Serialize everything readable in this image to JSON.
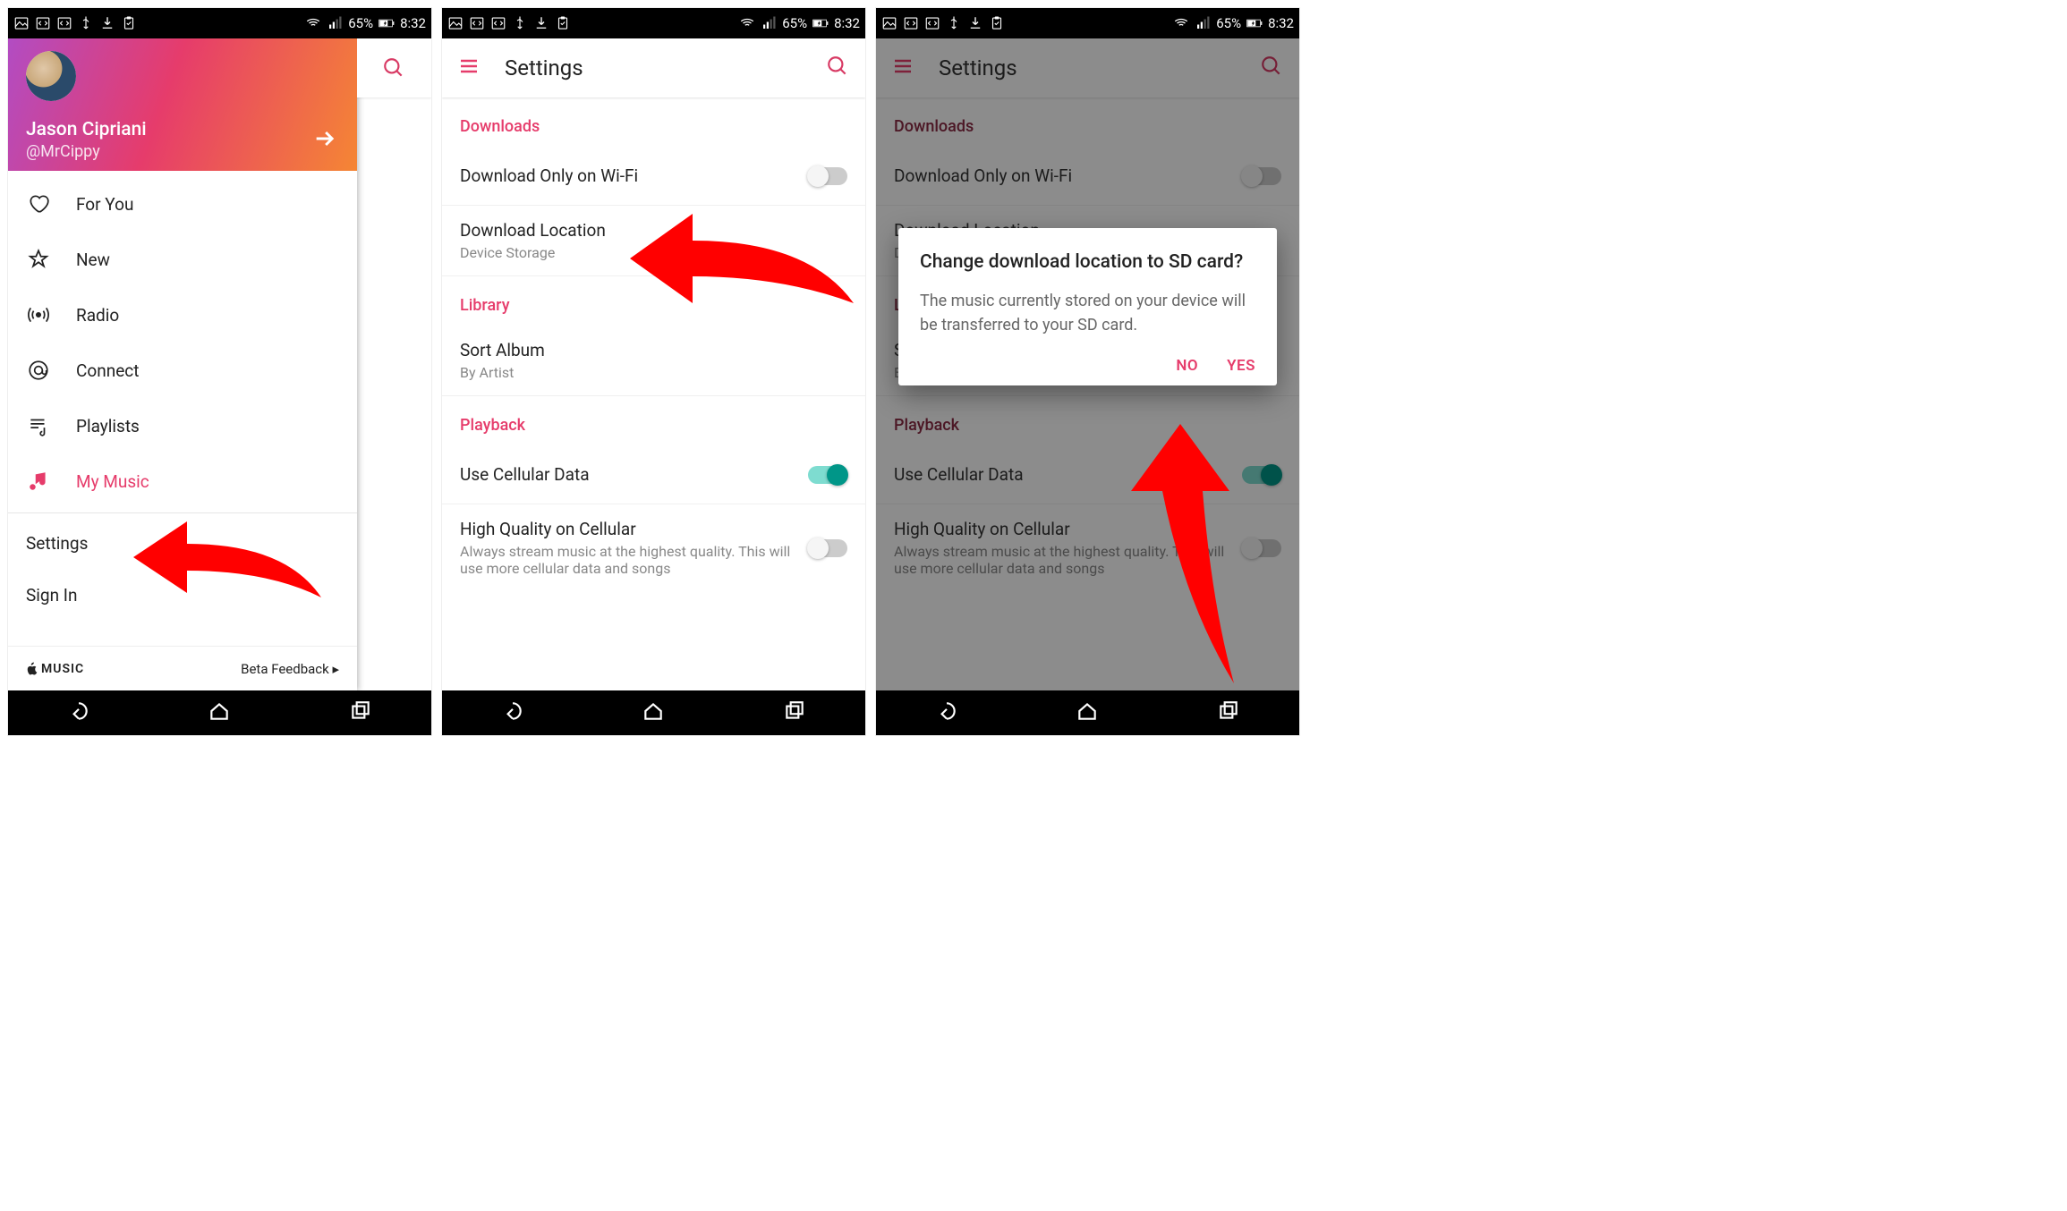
{
  "status_bar": {
    "battery_percent": "65%",
    "time": "8:32"
  },
  "panel1": {
    "profile": {
      "name": "Jason Cipriani",
      "handle": "@MrCippy"
    },
    "nav_items": [
      {
        "label": "For You"
      },
      {
        "label": "New"
      },
      {
        "label": "Radio"
      },
      {
        "label": "Connect"
      },
      {
        "label": "Playlists"
      },
      {
        "label": "My Music"
      }
    ],
    "settings_label": "Settings",
    "signin_label": "Sign In",
    "footer_brand": "MUSIC",
    "footer_beta": "Beta Feedback ▸"
  },
  "panel2": {
    "app_title": "Settings",
    "sections": {
      "downloads": {
        "header": "Downloads",
        "wifi_only": "Download Only on Wi-Fi",
        "location_title": "Download Location",
        "location_sub": "Device Storage"
      },
      "library": {
        "header": "Library",
        "sort_title": "Sort Album",
        "sort_sub": "By Artist"
      },
      "playback": {
        "header": "Playback",
        "cellular": "Use Cellular Data",
        "hq_title": "High Quality on Cellular",
        "hq_sub": "Always stream music at the highest quality. This will use more cellular data and songs"
      }
    }
  },
  "panel3": {
    "dialog": {
      "title": "Change download location to SD card?",
      "body": "The music currently stored on your device will be transferred to your SD card.",
      "no": "NO",
      "yes": "YES"
    }
  }
}
